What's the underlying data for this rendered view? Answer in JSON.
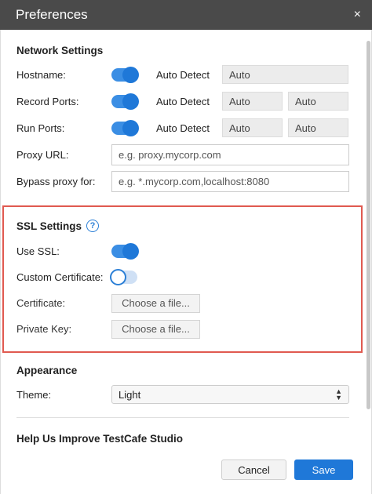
{
  "window": {
    "title": "Preferences",
    "close_glyph": "×"
  },
  "network": {
    "title": "Network Settings",
    "hostname": {
      "label": "Hostname:",
      "mode": "Auto Detect",
      "value": "Auto",
      "auto_detect": true
    },
    "record_ports": {
      "label": "Record Ports:",
      "mode": "Auto Detect",
      "value1": "Auto",
      "value2": "Auto",
      "auto_detect": true
    },
    "run_ports": {
      "label": "Run Ports:",
      "mode": "Auto Detect",
      "value1": "Auto",
      "value2": "Auto",
      "auto_detect": true
    },
    "proxy_url": {
      "label": "Proxy URL:",
      "placeholder": "e.g. proxy.mycorp.com"
    },
    "bypass_proxy": {
      "label": "Bypass proxy for:",
      "placeholder": "e.g. *.mycorp.com,localhost:8080"
    }
  },
  "ssl": {
    "title": "SSL Settings",
    "help_glyph": "?",
    "use_ssl": {
      "label": "Use SSL:",
      "enabled": true
    },
    "custom_certificate": {
      "label": "Custom Certificate:",
      "enabled": false
    },
    "certificate": {
      "label": "Certificate:",
      "button": "Choose a file..."
    },
    "private_key": {
      "label": "Private Key:",
      "button": "Choose a file..."
    }
  },
  "appearance": {
    "title": "Appearance",
    "theme": {
      "label": "Theme:",
      "selected": "Light"
    }
  },
  "next_section_title": "Help Us Improve TestCafe Studio",
  "footer": {
    "cancel": "Cancel",
    "save": "Save"
  },
  "colors": {
    "accent": "#1f78d8",
    "highlight_border": "#e05a50",
    "titlebar": "#4a4a4a"
  }
}
